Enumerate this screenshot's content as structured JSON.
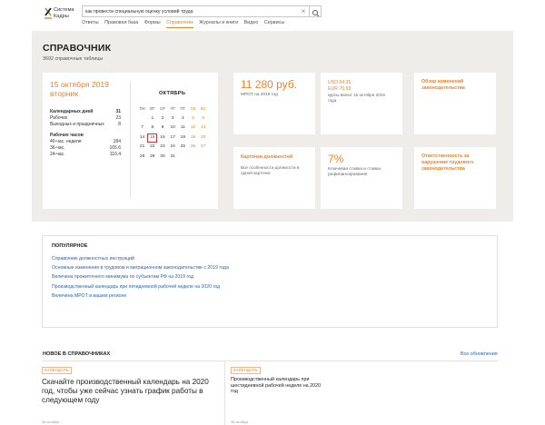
{
  "header": {
    "logo_line1": "Система",
    "logo_line2": "Кадры",
    "search_value": "как провести специальную оценку условий труда",
    "nav": [
      "Ответы",
      "Правовая база",
      "Формы",
      "Справочник",
      "Журналы и книги",
      "Видео",
      "Сервисы"
    ],
    "nav_active": "Справочник"
  },
  "banner": {
    "title": "СПРАВОЧНИК",
    "subtitle": "3692 справочные таблицы"
  },
  "calendar": {
    "date_line1": "15 октября 2019",
    "date_line2": "вторник",
    "days_header": "Календарных дней",
    "days_total": "31",
    "workdays_label": "Рабочих",
    "workdays_value": "23",
    "weekends_label": "Выходных и праздничных",
    "weekends_value": "8",
    "hours_header": "Рабочих часов",
    "h40_label": "40-час. неделя",
    "h40_value": "184",
    "h36_label": "36-час.",
    "h36_value": "165.6",
    "h24_label": "24-час.",
    "h24_value": "110.4",
    "month": "ОКТЯБРЬ",
    "weekday_names": [
      "ПН",
      "ВТ",
      "СР",
      "ЧТ",
      "ПТ",
      "СБ",
      "ВС"
    ],
    "weeks": [
      [
        "",
        "1",
        "2",
        "3",
        "4",
        "5",
        "6"
      ],
      [
        "7",
        "8",
        "9",
        "10",
        "11",
        "12",
        "13"
      ],
      [
        "14",
        "15",
        "16",
        "17",
        "18",
        "19",
        "20"
      ],
      [
        "21",
        "22",
        "23",
        "24",
        "25",
        "26",
        "27"
      ],
      [
        "28",
        "29",
        "30",
        "31",
        "",
        "",
        ""
      ]
    ],
    "today": "15"
  },
  "cards": {
    "mrot_value": "11 280 руб.",
    "mrot_note": "МРОТ на 2019 год",
    "usd": "USD 64.35",
    "eur": "EUR 70.93",
    "rates_note": "курсы валют 15 октября 2019 года",
    "changes_link": "Обзор изменений законодательства",
    "job_cards_title": "Карточки должностей",
    "job_cards_desc": "Все особенности должности в одной карточке",
    "percent_value": "7%",
    "percent_note": "Ключевая ставка и ставка рефинансирования",
    "liability_link": "Ответственность за нарушение трудового законодательства"
  },
  "popular": {
    "title": "ПОПУЛЯРНОЕ",
    "links": [
      "Справочник должностных инструкций",
      "Основные изменения в трудовом и миграционном законодательстве с 2019 года",
      "Величина прожиточного минимума по субъектам РФ на 2019 год",
      "Производственный календарь при пятидневной рабочей неделе на 2020 год",
      "Величина МРОТ в вашем регионе"
    ]
  },
  "news": {
    "title": "НОВОЕ В СПРАВОЧНИКАХ",
    "all_link": "Все обновления",
    "items": [
      {
        "badge": "КАЛЕНДАРЬ",
        "text": "Скачайте производственный календарь на 2020 год, чтобы уже сейчас узнать график работы в следующем году",
        "date": "08 октября"
      },
      {
        "badge": "КАЛЕНДАРЬ",
        "text": "Производственный календарь при шестидневной рабочей неделе на 2020 год",
        "date": "08 октября"
      }
    ]
  },
  "colors": {
    "accent": "#e8842c",
    "link": "#2a64b7",
    "banner_bg": "#efedea",
    "today_outline": "#c8333a"
  }
}
